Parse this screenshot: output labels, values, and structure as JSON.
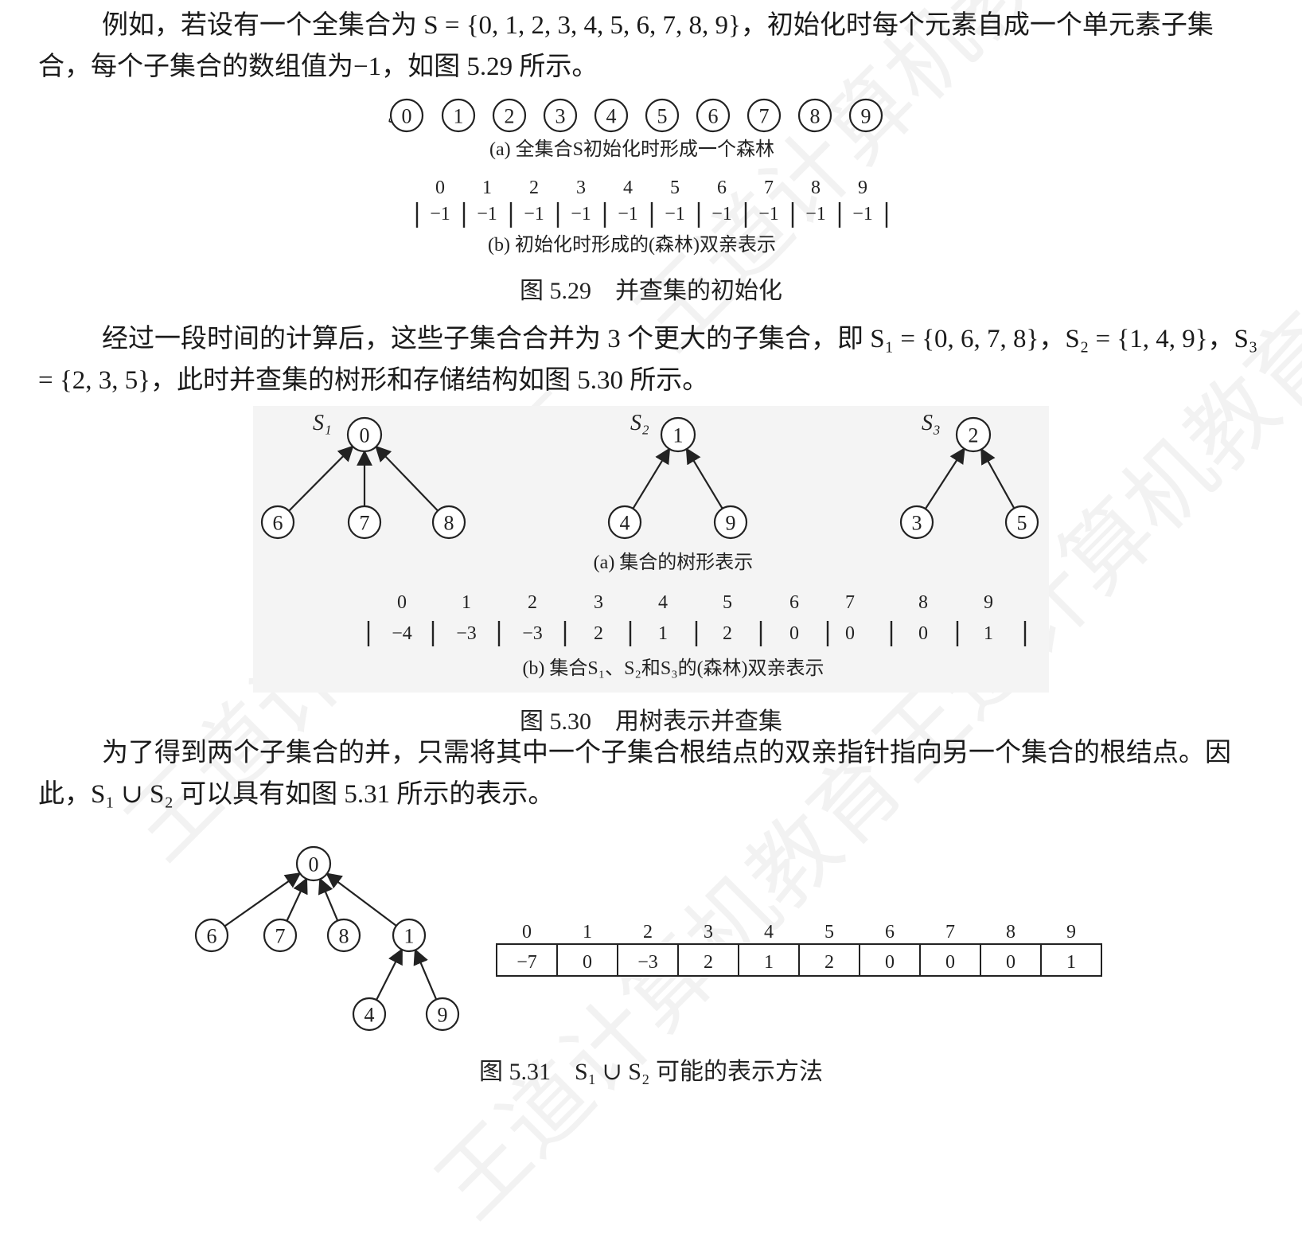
{
  "paragraphs": {
    "p1": "例如，若设有一个全集合为 S = {0, 1, 2, 3, 4, 5, 6, 7, 8, 9}，初始化时每个元素自成一个单元素子集合，每个子集合的数组值为−1，如图 5.29 所示。",
    "p2": "经过一段时间的计算后，这些子集合合并为 3 个更大的子集合，即 S₁ = {0, 6, 7, 8}，S₂ = {1, 4, 9}，S₃ = {2, 3, 5}，此时并查集的树形和存储结构如图 5.30 所示。",
    "p3": "为了得到两个子集合的并，只需将其中一个子集合根结点的双亲指针指向另一个集合的根结点。因此，S₁ ∪ S₂ 可以具有如图 5.31 所示的表示。"
  },
  "fig529": {
    "set_label": "S",
    "nodes": [
      "0",
      "1",
      "2",
      "3",
      "4",
      "5",
      "6",
      "7",
      "8",
      "9"
    ],
    "caption_a": "(a) 全集合S初始化时形成一个森林",
    "indices": [
      "0",
      "1",
      "2",
      "3",
      "4",
      "5",
      "6",
      "7",
      "8",
      "9"
    ],
    "values": [
      "−1",
      "−1",
      "−1",
      "−1",
      "−1",
      "−1",
      "−1",
      "−1",
      "−1",
      "−1"
    ],
    "caption_b": "(b) 初始化时形成的(森林)双亲表示",
    "title": "图 5.29　并查集的初始化"
  },
  "fig530": {
    "trees": [
      {
        "label": "S₁",
        "root": "0",
        "children": [
          "6",
          "7",
          "8"
        ]
      },
      {
        "label": "S₂",
        "root": "1",
        "children": [
          "4",
          "9"
        ]
      },
      {
        "label": "S₃",
        "root": "2",
        "children": [
          "3",
          "5"
        ]
      }
    ],
    "caption_a": "(a) 集合的树形表示",
    "indices": [
      "0",
      "1",
      "2",
      "3",
      "4",
      "5",
      "6",
      "7",
      "8",
      "9"
    ],
    "values": [
      "−4",
      "−3",
      "−3",
      "2",
      "1",
      "2",
      "0",
      "0",
      "0",
      "1"
    ],
    "caption_b": "(b) 集合S₁、S₂和S₃的(森林)双亲表示",
    "title": "图 5.30　用树表示并查集"
  },
  "fig531": {
    "root": "0",
    "level1": [
      "6",
      "7",
      "8",
      "1"
    ],
    "level2": [
      "4",
      "9"
    ],
    "indices": [
      "0",
      "1",
      "2",
      "3",
      "4",
      "5",
      "6",
      "7",
      "8",
      "9"
    ],
    "values": [
      "−7",
      "0",
      "−3",
      "2",
      "1",
      "2",
      "0",
      "0",
      "0",
      "1"
    ],
    "title": "图 5.31　S₁ ∪ S₂ 可能的表示方法"
  },
  "watermark": "王道计算机教育"
}
